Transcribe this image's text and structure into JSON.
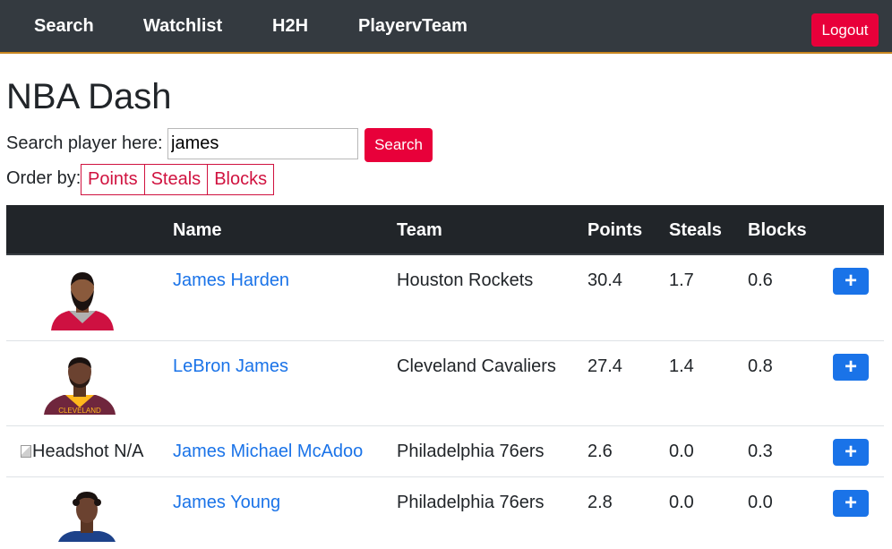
{
  "nav": {
    "links": [
      "Search",
      "Watchlist",
      "H2H",
      "PlayervTeam"
    ],
    "logout_label": "Logout"
  },
  "page": {
    "title": "NBA Dash",
    "search_label": "Search player here:",
    "search_value": "james",
    "search_button": "Search",
    "order_label": "Order by:",
    "order_options": [
      "Points",
      "Steals",
      "Blocks"
    ]
  },
  "table": {
    "headers": [
      "",
      "Name",
      "Team",
      "Points",
      "Steals",
      "Blocks",
      ""
    ],
    "rows": [
      {
        "name": "James Harden",
        "team": "Houston Rockets",
        "points": "30.4",
        "steals": "1.7",
        "blocks": "0.6",
        "headshot": "jersey-red",
        "action": "+"
      },
      {
        "name": "LeBron James",
        "team": "Cleveland Cavaliers",
        "points": "27.4",
        "steals": "1.4",
        "blocks": "0.8",
        "headshot": "jersey-wine",
        "action": "+"
      },
      {
        "name": "James Michael McAdoo",
        "team": "Philadelphia 76ers",
        "points": "2.6",
        "steals": "0.0",
        "blocks": "0.3",
        "headshot_alt": "Headshot N/A",
        "action": "+"
      },
      {
        "name": "James Young",
        "team": "Philadelphia 76ers",
        "points": "2.8",
        "steals": "0.0",
        "blocks": "0.0",
        "headshot": "jersey-white",
        "action": "+"
      }
    ]
  },
  "colors": {
    "navbar": "#343a40",
    "accent_red": "#e8003a",
    "link_blue": "#1a73e8",
    "table_header": "#212529"
  }
}
